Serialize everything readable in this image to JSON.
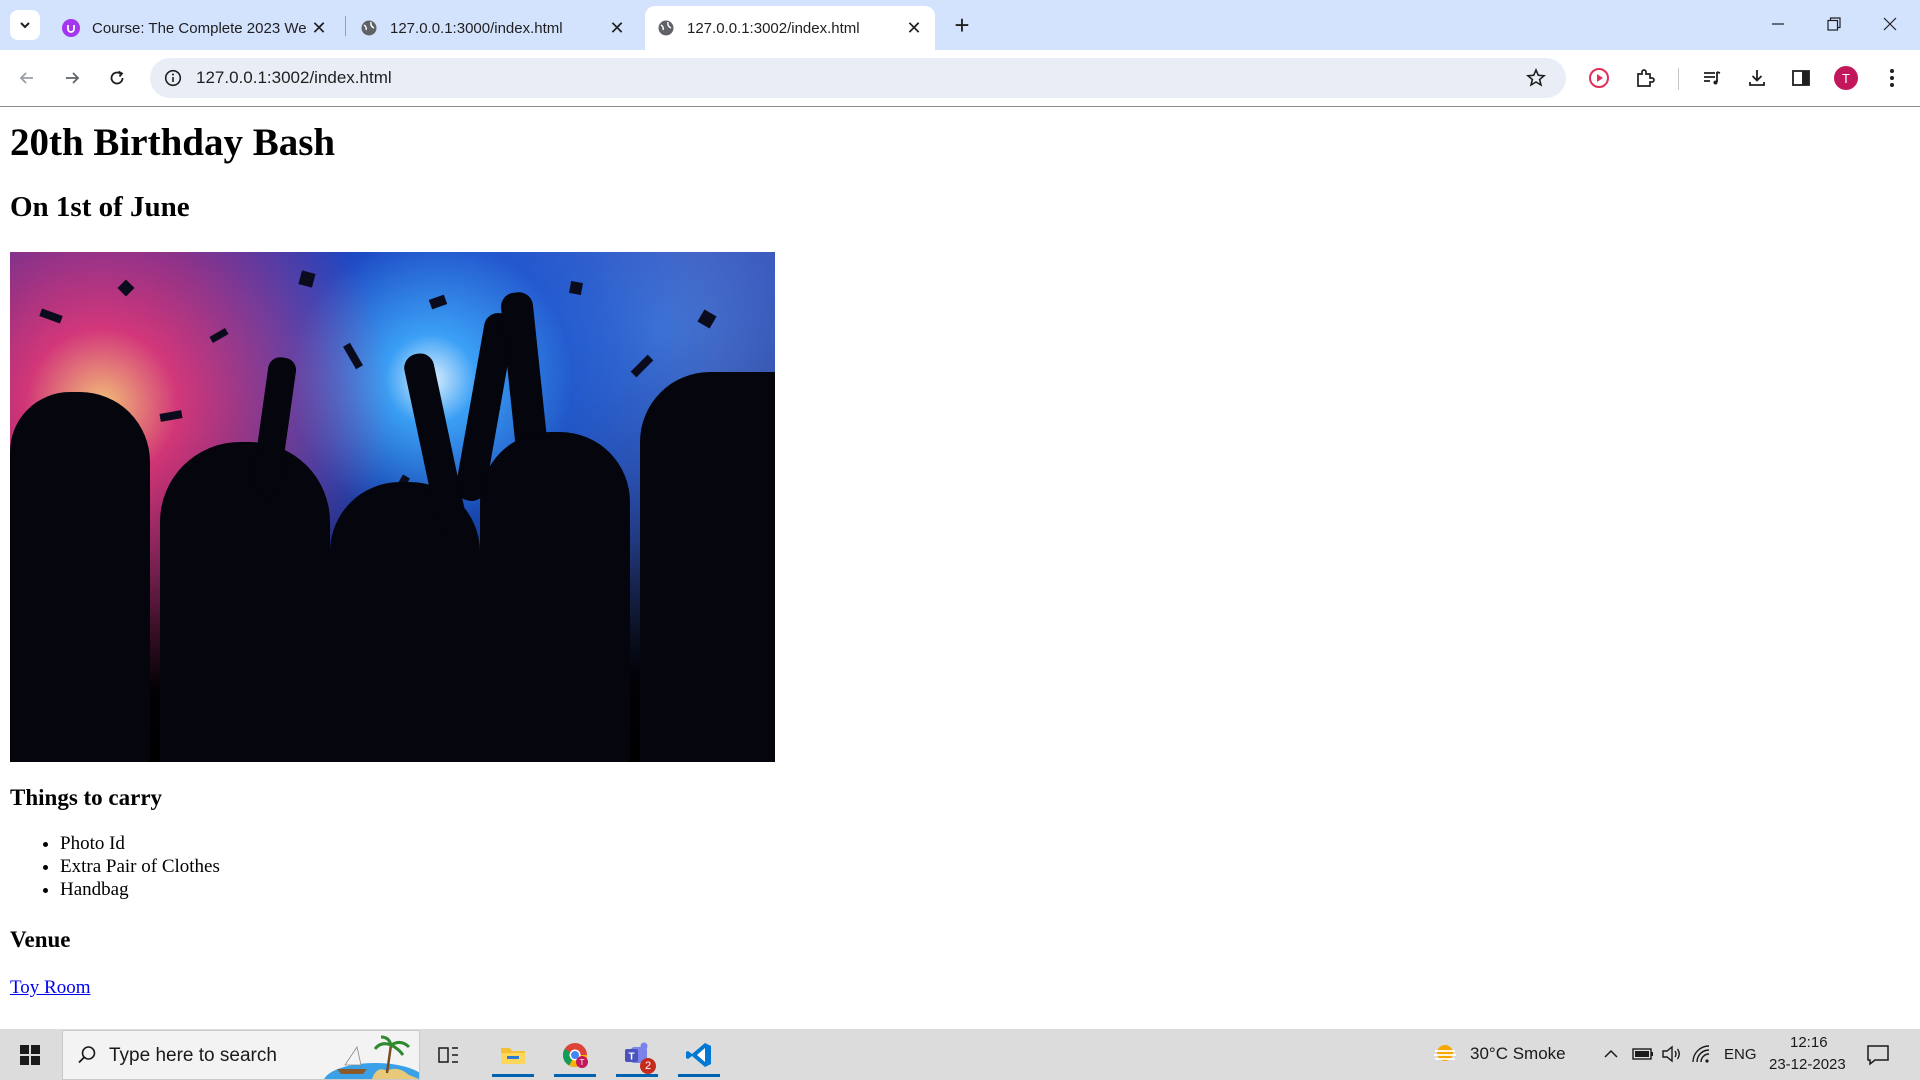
{
  "browser": {
    "tabs": [
      {
        "title": "Course: The Complete 2023 We",
        "active": false
      },
      {
        "title": "127.0.0.1:3000/index.html",
        "active": false
      },
      {
        "title": "127.0.0.1:3002/index.html",
        "active": true
      }
    ],
    "url": "127.0.0.1:3002/index.html",
    "profile_initial": "T",
    "accent": "#d3e3fd"
  },
  "page": {
    "title": "20th Birthday Bash",
    "subtitle": "On 1st of June",
    "things_heading": "Things to carry",
    "things": [
      "Photo Id",
      "Extra Pair of Clothes",
      "Handbag"
    ],
    "venue_heading": "Venue",
    "venue_link": "Toy Room",
    "link_color": "#0000ee"
  },
  "taskbar": {
    "search_placeholder": "Type here to search",
    "teams_badge": "2",
    "weather": "30°C  Smoke",
    "language": "ENG",
    "time": "12:16",
    "date": "23-12-2023"
  }
}
